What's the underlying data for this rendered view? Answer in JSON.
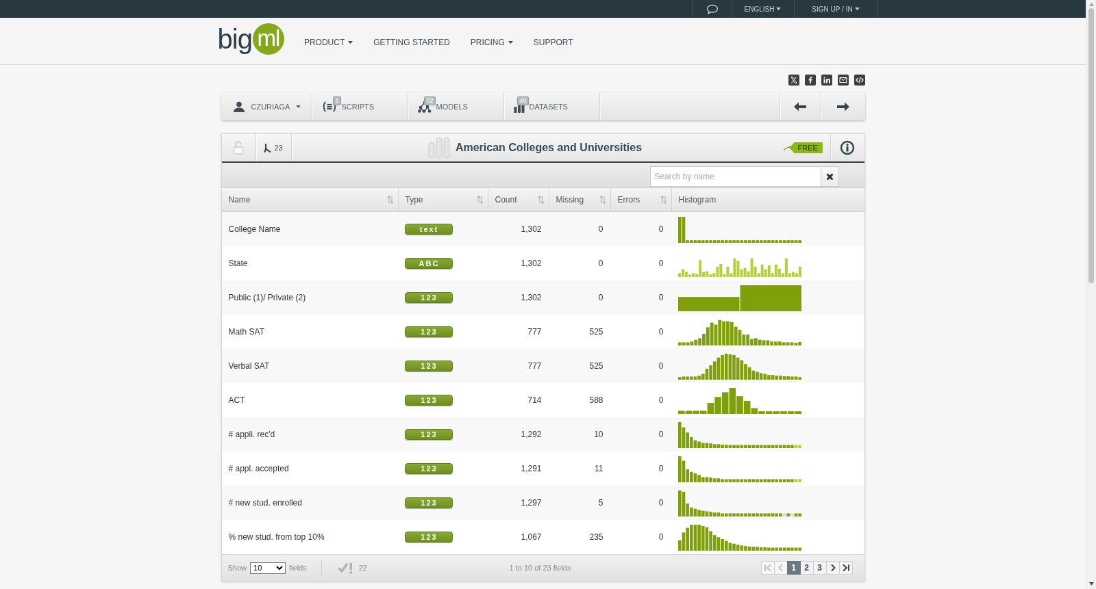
{
  "top_bar": {
    "language": "ENGLISH",
    "account": "SIGN UP / IN"
  },
  "header": {
    "logo": [
      "big",
      "ml"
    ],
    "nav": [
      {
        "label": "PRODUCT",
        "dropdown": true
      },
      {
        "label": "GETTING STARTED",
        "dropdown": false
      },
      {
        "label": "PRICING",
        "dropdown": true
      },
      {
        "label": "SUPPORT",
        "dropdown": false
      }
    ]
  },
  "toolbar": {
    "user": "CZURIAGA",
    "sections": [
      {
        "kind": "scripts",
        "label": "SCRIPTS",
        "count": "1"
      },
      {
        "kind": "models",
        "label": "MODELS",
        "count": "52"
      },
      {
        "kind": "datasets",
        "label": "DATASETS",
        "count": "49"
      }
    ]
  },
  "dataset": {
    "locked": false,
    "forks": "23",
    "title": "American Colleges and Universities",
    "price_tag": "FREE"
  },
  "search": {
    "placeholder": "Search by name"
  },
  "table": {
    "columns": [
      {
        "label": "Name",
        "sortable": true
      },
      {
        "label": "Type",
        "sortable": true
      },
      {
        "label": "Count",
        "sortable": true
      },
      {
        "label": "Missing",
        "sortable": true
      },
      {
        "label": "Errors",
        "sortable": true
      },
      {
        "label": "Histogram",
        "sortable": false
      }
    ],
    "rows": [
      {
        "name": "College Name",
        "type": "text",
        "count": "1,302",
        "missing": "0",
        "errors": "0"
      },
      {
        "name": "State",
        "type": "ABC",
        "count": "1,302",
        "missing": "0",
        "errors": "0"
      },
      {
        "name": "Public (1)/ Private (2)",
        "type": "123",
        "count": "1,302",
        "missing": "0",
        "errors": "0"
      },
      {
        "name": "Math SAT",
        "type": "123",
        "count": "777",
        "missing": "525",
        "errors": "0"
      },
      {
        "name": "Verbal SAT",
        "type": "123",
        "count": "777",
        "missing": "525",
        "errors": "0"
      },
      {
        "name": "ACT",
        "type": "123",
        "count": "714",
        "missing": "588",
        "errors": "0"
      },
      {
        "name": "# appli. rec'd",
        "type": "123",
        "count": "1,292",
        "missing": "10",
        "errors": "0"
      },
      {
        "name": "# appl. accepted",
        "type": "123",
        "count": "1,291",
        "missing": "11",
        "errors": "0"
      },
      {
        "name": "# new stud. enrolled",
        "type": "123",
        "count": "1,297",
        "missing": "5",
        "errors": "0"
      },
      {
        "name": "% new stud. from top 10%",
        "type": "123",
        "count": "1,067",
        "missing": "235",
        "errors": "0"
      }
    ]
  },
  "footer": {
    "show_label": "Show",
    "page_size": "10",
    "fields_label": "fields",
    "issues": "22",
    "range": "1 to 10 of 23 fields",
    "nav_buttons": [
      {
        "kind": "first",
        "disabled": true
      },
      {
        "kind": "previous",
        "disabled": true
      },
      {
        "kind": "next",
        "disabled": false
      },
      {
        "kind": "last",
        "disabled": false
      }
    ],
    "pages": [
      {
        "label": "1",
        "selected": true
      },
      {
        "label": "2",
        "selected": false
      },
      {
        "label": "3",
        "selected": false
      }
    ]
  }
}
